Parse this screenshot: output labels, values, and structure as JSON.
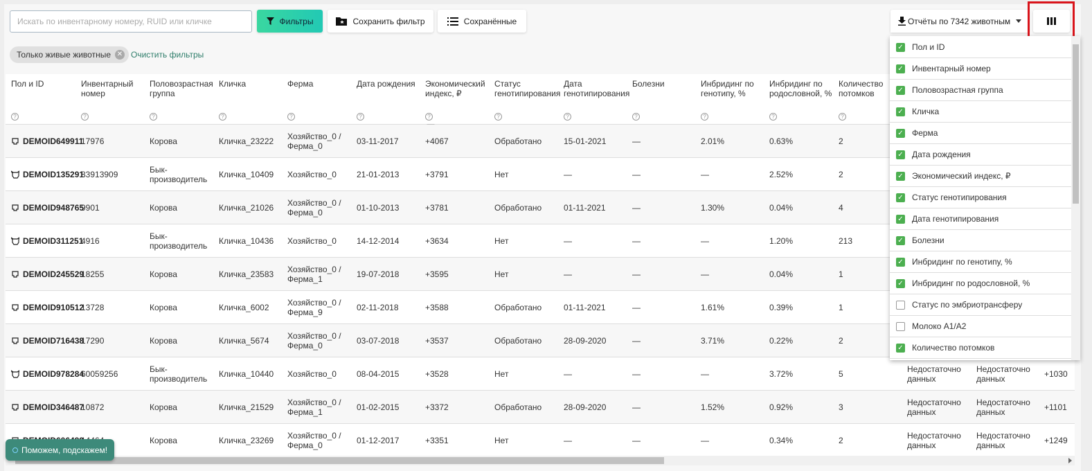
{
  "toolbar": {
    "search_placeholder": "Искать по инвентарному номеру, RUID или кличке",
    "filters": "Фильтры",
    "save_filter": "Сохранить фильтр",
    "saved": "Сохранённые",
    "reports": "Отчёты по 7342 животным"
  },
  "filters": {
    "chip": "Только живые животные",
    "clear": "Очистить фильтры"
  },
  "columns": [
    "Пол и ID",
    "Инвентарный номер",
    "Половозрастная группа",
    "Кличка",
    "Ферма",
    "Дата рождения",
    "Экономический индекс, ₽",
    "Статус генотипирования",
    "Дата генотипирования",
    "Болезни",
    "Инбридинг по генотипу, %",
    "Инбридинг по родословной, %",
    "Количество потомков"
  ],
  "rows": [
    {
      "sex": "cow",
      "id": "DEMOID649911",
      "inv": "17976",
      "group": "Корова",
      "name": "Кличка_23222",
      "farm": "Хозяйство_0 / Ферма_0",
      "birth": "03-11-2017",
      "index": "+4067",
      "gstatus": "Обработано",
      "gdate": "15-01-2021",
      "disease": "—",
      "ig": "2.01%",
      "ip": "0.63%",
      "off": "2"
    },
    {
      "sex": "bull",
      "id": "DEMOID135291",
      "inv": "83913909",
      "group": "Бык-производитель",
      "name": "Кличка_10409",
      "farm": "Хозяйство_0",
      "birth": "21-01-2013",
      "index": "+3791",
      "gstatus": "Нет",
      "gdate": "—",
      "disease": "—",
      "ig": "—",
      "ip": "2.52%",
      "off": "2"
    },
    {
      "sex": "cow",
      "id": "DEMOID948765",
      "inv": "9901",
      "group": "Корова",
      "name": "Кличка_21026",
      "farm": "Хозяйство_0 / Ферма_0",
      "birth": "01-10-2013",
      "index": "+3781",
      "gstatus": "Обработано",
      "gdate": "01-11-2021",
      "disease": "—",
      "ig": "1.30%",
      "ip": "0.04%",
      "off": "4"
    },
    {
      "sex": "bull",
      "id": "DEMOID311251",
      "inv": "4916",
      "group": "Бык-производитель",
      "name": "Кличка_10436",
      "farm": "Хозяйство_0",
      "birth": "14-12-2014",
      "index": "+3634",
      "gstatus": "Нет",
      "gdate": "—",
      "disease": "—",
      "ig": "—",
      "ip": "1.20%",
      "off": "213"
    },
    {
      "sex": "cow",
      "id": "DEMOID245529",
      "inv": "18255",
      "group": "Корова",
      "name": "Кличка_23583",
      "farm": "Хозяйство_0 / Ферма_1",
      "birth": "19-07-2018",
      "index": "+3595",
      "gstatus": "Нет",
      "gdate": "—",
      "disease": "—",
      "ig": "—",
      "ip": "0.04%",
      "off": "1"
    },
    {
      "sex": "cow",
      "id": "DEMOID910512",
      "inv": "13728",
      "group": "Корова",
      "name": "Кличка_6002",
      "farm": "Хозяйство_0 / Ферма_9",
      "birth": "02-11-2018",
      "index": "+3588",
      "gstatus": "Обработано",
      "gdate": "01-11-2021",
      "disease": "—",
      "ig": "1.61%",
      "ip": "0.39%",
      "off": "1"
    },
    {
      "sex": "cow",
      "id": "DEMOID716438",
      "inv": "17290",
      "group": "Корова",
      "name": "Кличка_5674",
      "farm": "Хозяйство_0 / Ферма_0",
      "birth": "03-07-2018",
      "index": "+3537",
      "gstatus": "Обработано",
      "gdate": "28-09-2020",
      "disease": "—",
      "ig": "3.71%",
      "ip": "0.22%",
      "off": "2"
    },
    {
      "sex": "bull",
      "id": "DEMOID978284",
      "inv": "60059256",
      "group": "Бык-производитель",
      "name": "Кличка_10440",
      "farm": "Хозяйство_0",
      "birth": "08-04-2015",
      "index": "+3528",
      "gstatus": "Нет",
      "gdate": "—",
      "disease": "—",
      "ig": "—",
      "ip": "3.72%",
      "off": "5",
      "x1": "Недостаточно данных",
      "x2": "Недостаточно данных",
      "x3": "+1030"
    },
    {
      "sex": "cow",
      "id": "DEMOID346487",
      "inv": "10872",
      "group": "Корова",
      "name": "Кличка_21529",
      "farm": "Хозяйство_0 / Ферма_1",
      "birth": "01-02-2015",
      "index": "+3372",
      "gstatus": "Обработано",
      "gdate": "28-09-2020",
      "disease": "—",
      "ig": "1.52%",
      "ip": "0.92%",
      "off": "3",
      "x1": "Недостаточно данных",
      "x2": "Недостаточно данных",
      "x3": "+1101"
    },
    {
      "sex": "cow",
      "id": "DEMOID606499",
      "inv": "14464",
      "group": "Корова",
      "name": "Кличка_23269",
      "farm": "Хозяйство_0 / Ферма_0",
      "birth": "01-12-2017",
      "index": "+3351",
      "gstatus": "Нет",
      "gdate": "—",
      "disease": "—",
      "ig": "—",
      "ip": "0.34%",
      "off": "2",
      "x1": "Недостаточно данных",
      "x2": "Недостаточно данных",
      "x3": "+1249"
    }
  ],
  "column_picker": [
    {
      "label": "Пол и ID",
      "checked": true
    },
    {
      "label": "Инвентарный номер",
      "checked": true
    },
    {
      "label": "Половозрастная группа",
      "checked": true
    },
    {
      "label": "Кличка",
      "checked": true
    },
    {
      "label": "Ферма",
      "checked": true
    },
    {
      "label": "Дата рождения",
      "checked": true
    },
    {
      "label": "Экономический индекс, ₽",
      "checked": true
    },
    {
      "label": "Статус генотипирования",
      "checked": true
    },
    {
      "label": "Дата генотипирования",
      "checked": true
    },
    {
      "label": "Болезни",
      "checked": true
    },
    {
      "label": "Инбридинг по генотипу, %",
      "checked": true
    },
    {
      "label": "Инбридинг по родословной, %",
      "checked": true
    },
    {
      "label": "Статус по эмбриотрансферу",
      "checked": false
    },
    {
      "label": "Молоко A1/A2",
      "checked": false
    },
    {
      "label": "Количество потомков",
      "checked": true
    }
  ],
  "help": "Поможем, подскажем!",
  "colors": {
    "accent": "#2ad0aa",
    "check": "#4caf50",
    "help": "#3d8a7a",
    "highlight": "#d9141b"
  }
}
